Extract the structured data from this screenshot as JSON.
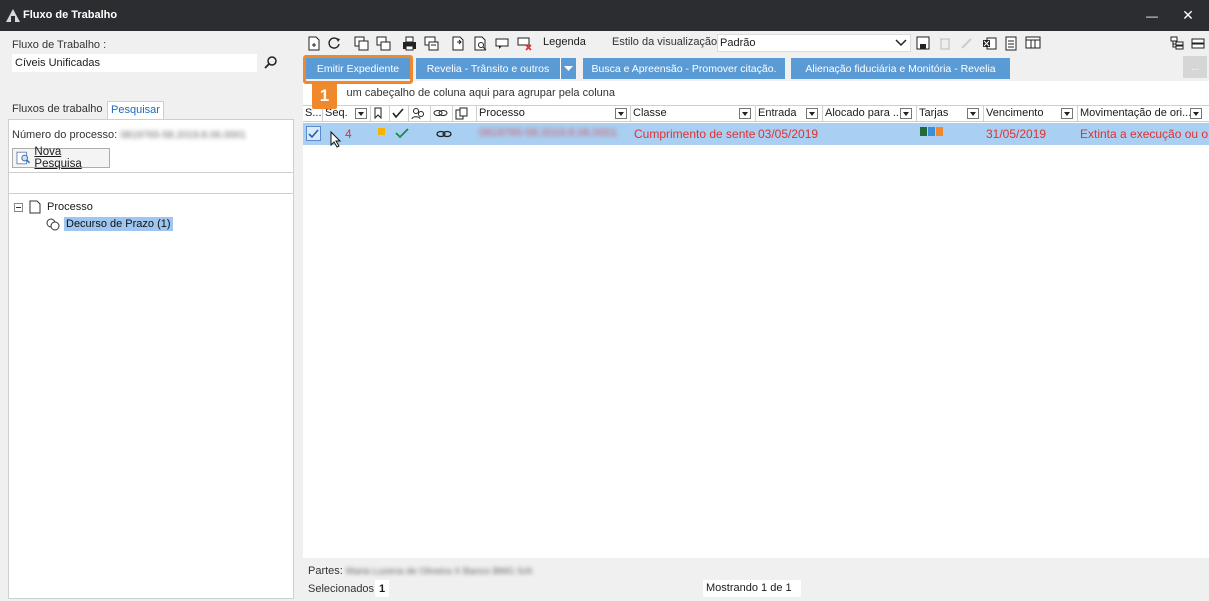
{
  "window": {
    "title": "Fluxo de Trabalho",
    "minimize_glyph": "—",
    "close_glyph": "✕"
  },
  "left": {
    "workflow_label": "Fluxo de Trabalho :",
    "workflow_value": "Cíveis Unificadas",
    "tabs": [
      "Fluxos de trabalho",
      "Pesquisar"
    ],
    "process_number_label": "Número do processo:",
    "process_number_value": "0819765-58.2019.8.06.0001",
    "new_search_button": "Nova Pesquisa",
    "tree": {
      "root": "Processo",
      "child": "Decurso de Prazo (1)"
    }
  },
  "toolbar": {
    "legend_label": "Legenda",
    "view_style_label": "Estilo da visualização",
    "view_style_value": "Padrão"
  },
  "actions": {
    "buttons": [
      "Emitir Expediente",
      "Revelia - Trânsito e outros",
      "Busca e Apreensão - Promover citação.",
      "Alienação fiduciária e Monitória - Revelia"
    ],
    "more_label": "...",
    "step_badge": "1"
  },
  "grid": {
    "group_hint": "Arraste um cabeçalho de coluna aqui para agrupar pela coluna",
    "group_hint_visible": "um cabeçalho de coluna aqui para agrupar pela coluna",
    "columns": [
      "S...",
      "Seq.",
      "Processo",
      "Classe",
      "Entrada",
      "Alocado para ...",
      "Tarjas",
      "Vencimento",
      "Movimentação de ori..."
    ],
    "row": {
      "seq": "4",
      "processo": "0819765-58.2019.8.06.0001",
      "classe": "Cumprimento de sentença",
      "entrada": "03/05/2019",
      "vencimento": "31/05/2019",
      "movimentacao": "Extinta a execução ou o cumprimento"
    },
    "tarja_colors": [
      "#1f6b3a",
      "#3c8fd6",
      "#f0882c"
    ],
    "flag_color": "#f5b400",
    "row_text_color": "#e0312f"
  },
  "footer": {
    "parts_label": "Partes:",
    "parts_value": "Maria Luzena de Oliveira X Banco BMG S/A",
    "selected_label": "Selecionados",
    "selected_value": "1",
    "showing": "Mostrando 1 de 1"
  }
}
